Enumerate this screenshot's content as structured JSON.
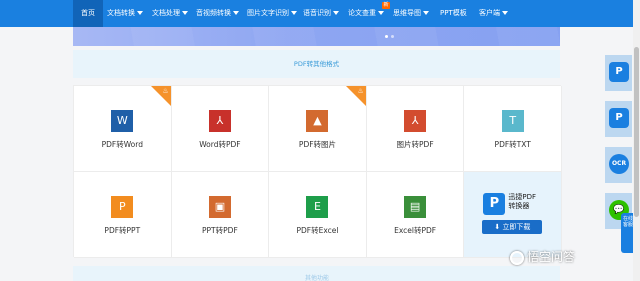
{
  "nav": {
    "items": [
      {
        "label": "首页",
        "dropdown": false
      },
      {
        "label": "文档转换",
        "dropdown": true
      },
      {
        "label": "文档处理",
        "dropdown": true
      },
      {
        "label": "音视频转换",
        "dropdown": true
      },
      {
        "label": "图片文字识别",
        "dropdown": true
      },
      {
        "label": "语音识别",
        "dropdown": true
      },
      {
        "label": "论文查重",
        "dropdown": true,
        "badge": "新"
      },
      {
        "label": "思维导图",
        "dropdown": true
      },
      {
        "label": "PPT模板",
        "dropdown": false
      },
      {
        "label": "客户端",
        "dropdown": true
      }
    ]
  },
  "section_title": "PDF转其他格式",
  "tools": [
    {
      "label": "PDF转Word",
      "icon": "word-icon",
      "glyph": "W",
      "color": "#1f5fa8",
      "hot": true
    },
    {
      "label": "Word转PDF",
      "icon": "pdf-icon",
      "glyph": "⅄",
      "color": "#c8312b",
      "hot": false
    },
    {
      "label": "PDF转图片",
      "icon": "image-icon",
      "glyph": "▲",
      "color": "#d36a2f",
      "hot": true
    },
    {
      "label": "图片转PDF",
      "icon": "pdf-icon",
      "glyph": "⅄",
      "color": "#d34c2f",
      "hot": false
    },
    {
      "label": "PDF转TXT",
      "icon": "txt-icon",
      "glyph": "T",
      "color": "#5ab8cc",
      "hot": false
    },
    {
      "label": "PDF转PPT",
      "icon": "ppt-icon",
      "glyph": "P",
      "color": "#f28c1f",
      "hot": false
    },
    {
      "label": "PPT转PDF",
      "icon": "slides-icon",
      "glyph": "▣",
      "color": "#d36a2f",
      "hot": false
    },
    {
      "label": "PDF转Excel",
      "icon": "excel-icon",
      "glyph": "E",
      "color": "#1e9e4a",
      "hot": false
    },
    {
      "label": "Excel转PDF",
      "icon": "xls-icon",
      "glyph": "▤",
      "color": "#3a8f3a",
      "hot": false
    }
  ],
  "promo": {
    "name_line1": "迅捷PDF",
    "name_line2": "转换器",
    "download": "立即下载",
    "logo": "P"
  },
  "bottom_strip": "其他功能",
  "side": {
    "items": [
      {
        "name": "pdf-app-icon",
        "glyph": "P"
      },
      {
        "name": "pdf-editor-icon",
        "glyph": "P"
      },
      {
        "name": "ocr-icon",
        "glyph": "OCR"
      },
      {
        "name": "wechat-icon",
        "glyph": "💬"
      }
    ],
    "float_tab": "在线客服"
  },
  "watermark": "悟空问答"
}
